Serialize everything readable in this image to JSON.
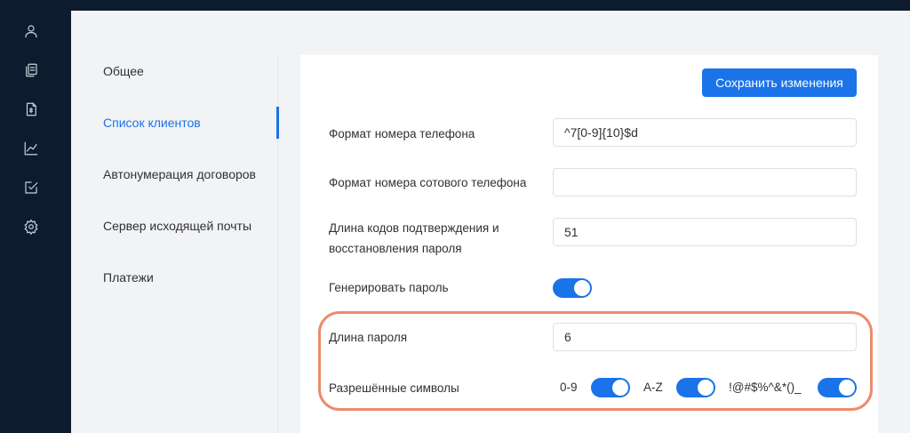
{
  "sidebar": {
    "icons": [
      "user-icon",
      "documents-icon",
      "contract-icon",
      "chart-icon",
      "tasks-icon",
      "settings-icon"
    ]
  },
  "settings_nav": {
    "items": [
      {
        "label": "Общее",
        "active": false
      },
      {
        "label": "Список клиентов",
        "active": true
      },
      {
        "label": "Автонумерация договоров",
        "active": false
      },
      {
        "label": "Сервер исходящей почты",
        "active": false
      },
      {
        "label": "Платежи",
        "active": false
      }
    ]
  },
  "panel": {
    "save_label": "Сохранить изменения",
    "phone_format_label": "Формат номера телефона",
    "phone_format_value": "^7[0-9]{10}$d",
    "mobile_format_label": "Формат номера сотового телефона",
    "mobile_format_value": "",
    "code_length_label_line1": "Длина кодов подтверждения и",
    "code_length_label_line2": "восстановления пароля",
    "code_length_value": "51",
    "generate_password_label": "Генерировать пароль",
    "generate_password_on": true,
    "password_length_label": "Длина пароля",
    "password_length_value": "6",
    "allowed_symbols_label": "Разрешённые символы",
    "symbols": [
      {
        "label": "0-9",
        "on": true
      },
      {
        "label": "A-Z",
        "on": true
      },
      {
        "label": "!@#$%^&*()_",
        "on": true
      }
    ]
  },
  "colors": {
    "accent": "#1a73e8",
    "sidebar_bg": "#0d1b2e",
    "highlight": "#ee8a6d"
  }
}
